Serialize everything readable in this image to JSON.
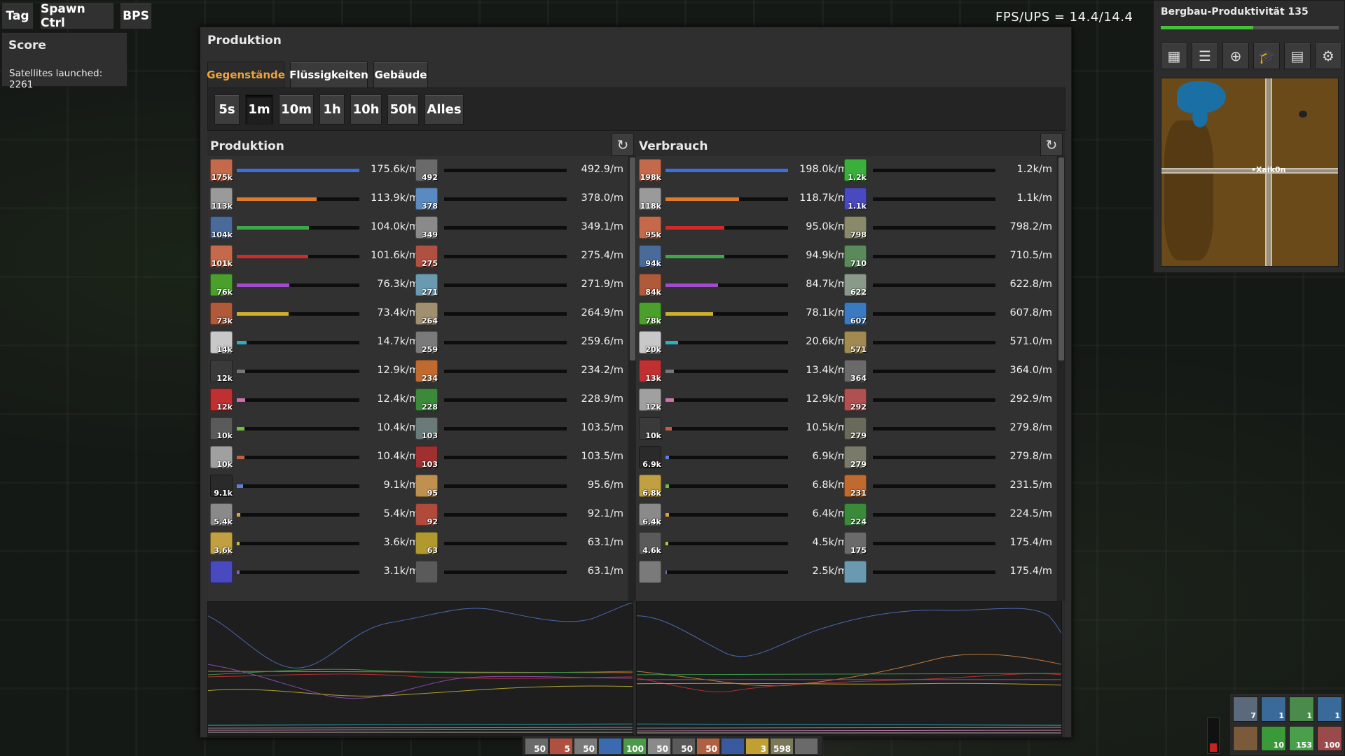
{
  "top_buttons": {
    "tag": "Tag",
    "spawn": "Spawn Ctrl",
    "bps": "BPS"
  },
  "score": {
    "title": "Score",
    "satellites": "Satellites launched:  2261"
  },
  "fps": "FPS/UPS = 14.4/14.4",
  "minimap": {
    "title": "Bergbau-Produktivität 135",
    "progress": 0.52,
    "player": "•Xaik0n",
    "buttons": [
      "map-view-icon",
      "stats-icon",
      "add-tag-icon",
      "research-icon",
      "train-icon",
      "settings-icon"
    ]
  },
  "window": {
    "title": "Produktion"
  },
  "tabs": [
    "Gegenstände",
    "Flüssigkeiten",
    "Gebäude"
  ],
  "timescales": [
    "5s",
    "1m",
    "10m",
    "1h",
    "10h",
    "50h",
    "Alles"
  ],
  "production": {
    "title": "Produktion",
    "left": [
      {
        "c": "175k",
        "rate": "175.6k/m",
        "f": 1.0,
        "col": "#3d6fe0",
        "ic": "#c46a4a"
      },
      {
        "c": "113k",
        "rate": "113.9k/m",
        "f": 0.65,
        "col": "#e07a2a",
        "ic": "#9a9a9a"
      },
      {
        "c": "104k",
        "rate": "104.0k/m",
        "f": 0.59,
        "col": "#3da84a",
        "ic": "#4a6a9a"
      },
      {
        "c": "101k",
        "rate": "101.6k/m",
        "f": 0.58,
        "col": "#d02a2a",
        "ic": "#c46a4a"
      },
      {
        "c": "76k",
        "rate": "76.3k/m",
        "f": 0.43,
        "col": "#a24ad0",
        "ic": "#4aa02a"
      },
      {
        "c": "73k",
        "rate": "73.4k/m",
        "f": 0.42,
        "col": "#d0b02a",
        "ic": "#b05a3a"
      },
      {
        "c": "14k",
        "rate": "14.7k/m",
        "f": 0.08,
        "col": "#2ab0c0",
        "ic": "#c8c8c8"
      },
      {
        "c": "12k",
        "rate": "12.9k/m",
        "f": 0.07,
        "col": "#777777",
        "ic": "#3a3a3a"
      },
      {
        "c": "12k",
        "rate": "12.4k/m",
        "f": 0.07,
        "col": "#d070b0",
        "ic": "#c03030"
      },
      {
        "c": "10k",
        "rate": "10.4k/m",
        "f": 0.06,
        "col": "#70c040",
        "ic": "#5a5a5a"
      },
      {
        "c": "10k",
        "rate": "10.4k/m",
        "f": 0.06,
        "col": "#c06040",
        "ic": "#a0a0a0"
      },
      {
        "c": "9.1k",
        "rate": "9.1k/m",
        "f": 0.05,
        "col": "#6080e0",
        "ic": "#2a2a2a"
      },
      {
        "c": "5.4k",
        "rate": "5.4k/m",
        "f": 0.03,
        "col": "#e0a040",
        "ic": "#8a8a8a"
      },
      {
        "c": "3.6k",
        "rate": "3.6k/m",
        "f": 0.02,
        "col": "#c0c040",
        "ic": "#c0a040"
      },
      {
        "c": "",
        "rate": "3.1k/m",
        "f": 0.02,
        "col": "#8060c0",
        "ic": "#4a4ac0"
      }
    ],
    "right": [
      {
        "c": "492",
        "rate": "492.9/m",
        "ic": "#6a6a6a"
      },
      {
        "c": "378",
        "rate": "378.0/m",
        "ic": "#5a8ac0"
      },
      {
        "c": "349",
        "rate": "349.1/m",
        "ic": "#8a8a8a"
      },
      {
        "c": "275",
        "rate": "275.4/m",
        "ic": "#b05040"
      },
      {
        "c": "271",
        "rate": "271.9/m",
        "ic": "#6a9ab0"
      },
      {
        "c": "264",
        "rate": "264.9/m",
        "ic": "#a09070"
      },
      {
        "c": "259",
        "rate": "259.6/m",
        "ic": "#7a7a7a"
      },
      {
        "c": "234",
        "rate": "234.2/m",
        "ic": "#c06a30"
      },
      {
        "c": "228",
        "rate": "228.9/m",
        "ic": "#3a8a3a"
      },
      {
        "c": "103",
        "rate": "103.5/m",
        "ic": "#6a7a7a"
      },
      {
        "c": "103",
        "rate": "103.5/m",
        "ic": "#a03030"
      },
      {
        "c": "95",
        "rate": "95.6/m",
        "ic": "#c09050"
      },
      {
        "c": "92",
        "rate": "92.1/m",
        "ic": "#b04a3a"
      },
      {
        "c": "63",
        "rate": "63.1/m",
        "ic": "#b09a30"
      },
      {
        "c": "",
        "rate": "63.1/m",
        "ic": "#5a5a5a"
      }
    ]
  },
  "consumption": {
    "title": "Verbrauch",
    "left": [
      {
        "c": "198k",
        "rate": "198.0k/m",
        "f": 1.0,
        "col": "#3d6fe0",
        "ic": "#c46a4a"
      },
      {
        "c": "118k",
        "rate": "118.7k/m",
        "f": 0.6,
        "col": "#e07a2a",
        "ic": "#9a9a9a"
      },
      {
        "c": "95k",
        "rate": "95.0k/m",
        "f": 0.48,
        "col": "#d02a2a",
        "ic": "#c46a4a"
      },
      {
        "c": "94k",
        "rate": "94.9k/m",
        "f": 0.48,
        "col": "#3da84a",
        "ic": "#4a6a9a"
      },
      {
        "c": "84k",
        "rate": "84.7k/m",
        "f": 0.43,
        "col": "#a24ad0",
        "ic": "#b05a3a"
      },
      {
        "c": "78k",
        "rate": "78.1k/m",
        "f": 0.39,
        "col": "#d0b02a",
        "ic": "#4aa02a"
      },
      {
        "c": "20k",
        "rate": "20.6k/m",
        "f": 0.1,
        "col": "#2ab0c0",
        "ic": "#c8c8c8"
      },
      {
        "c": "13k",
        "rate": "13.4k/m",
        "f": 0.07,
        "col": "#777777",
        "ic": "#c03030"
      },
      {
        "c": "12k",
        "rate": "12.9k/m",
        "f": 0.07,
        "col": "#d070b0",
        "ic": "#a0a0a0"
      },
      {
        "c": "10k",
        "rate": "10.5k/m",
        "f": 0.05,
        "col": "#c06040",
        "ic": "#3a3a3a"
      },
      {
        "c": "6.9k",
        "rate": "6.9k/m",
        "f": 0.03,
        "col": "#6080e0",
        "ic": "#2a2a2a"
      },
      {
        "c": "6.8k",
        "rate": "6.8k/m",
        "f": 0.03,
        "col": "#70c040",
        "ic": "#c0a040"
      },
      {
        "c": "6.4k",
        "rate": "6.4k/m",
        "f": 0.03,
        "col": "#e0a040",
        "ic": "#8a8a8a"
      },
      {
        "c": "4.6k",
        "rate": "4.5k/m",
        "f": 0.02,
        "col": "#c0c040",
        "ic": "#5a5a5a"
      },
      {
        "c": "",
        "rate": "2.5k/m",
        "f": 0.01,
        "col": "#8060c0",
        "ic": "#7a7a7a"
      }
    ],
    "right": [
      {
        "c": "1.2k",
        "rate": "1.2k/m",
        "ic": "#3ab03a"
      },
      {
        "c": "1.1k",
        "rate": "1.1k/m",
        "ic": "#4a4ac0"
      },
      {
        "c": "798",
        "rate": "798.2/m",
        "ic": "#8a8a6a"
      },
      {
        "c": "710",
        "rate": "710.5/m",
        "ic": "#5a8a5a"
      },
      {
        "c": "622",
        "rate": "622.8/m",
        "ic": "#8a9a8a"
      },
      {
        "c": "607",
        "rate": "607.8/m",
        "ic": "#3a7ac0"
      },
      {
        "c": "571",
        "rate": "571.0/m",
        "ic": "#a08a50"
      },
      {
        "c": "364",
        "rate": "364.0/m",
        "ic": "#6a6a6a"
      },
      {
        "c": "292",
        "rate": "292.9/m",
        "ic": "#b05050"
      },
      {
        "c": "279",
        "rate": "279.8/m",
        "ic": "#6a6a5a"
      },
      {
        "c": "279",
        "rate": "279.8/m",
        "ic": "#7a7a6a"
      },
      {
        "c": "231",
        "rate": "231.5/m",
        "ic": "#c06a30"
      },
      {
        "c": "224",
        "rate": "224.5/m",
        "ic": "#3a8a3a"
      },
      {
        "c": "175",
        "rate": "175.4/m",
        "ic": "#6a6a6a"
      },
      {
        "c": "",
        "rate": "175.4/m",
        "ic": "#6a9ab0"
      }
    ]
  },
  "hotbar": [
    "50",
    "5",
    "50",
    "",
    "100",
    "50",
    "50",
    "50",
    "",
    "3",
    "598",
    ""
  ],
  "quickbar": [
    "7",
    "1",
    "1",
    "1",
    "",
    "10",
    "153",
    "100"
  ]
}
